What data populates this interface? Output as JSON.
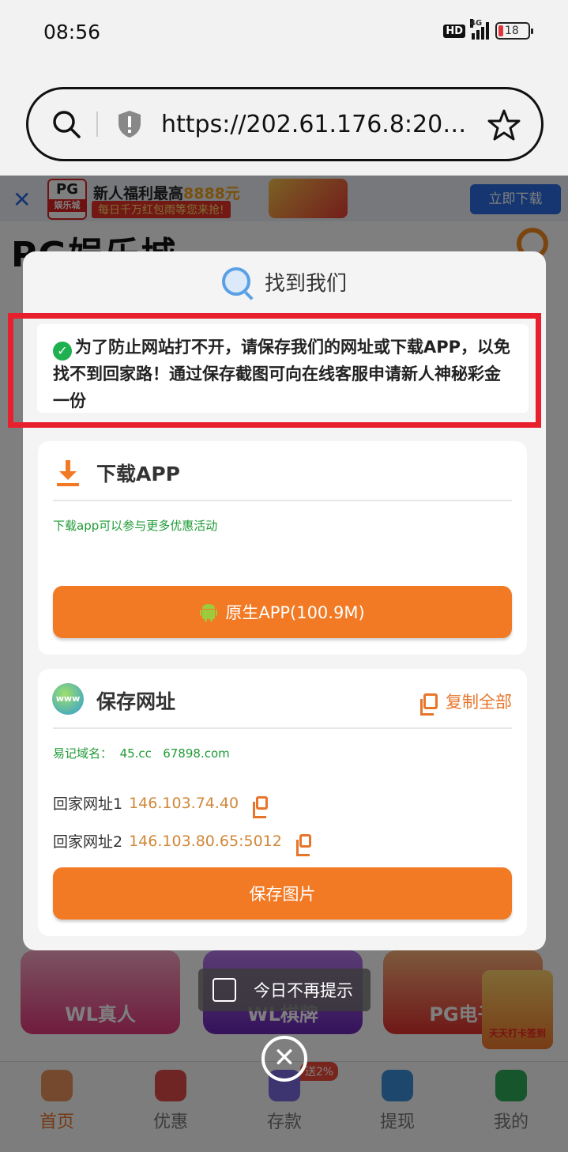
{
  "status_bar": {
    "time": "08:56",
    "hd": "HD",
    "network": "4G",
    "battery": "18"
  },
  "browser": {
    "url": "https://202.61.176.8:2000..."
  },
  "promo_banner": {
    "logo_top": "PG",
    "logo_bottom": "娱乐城",
    "title_prefix": "新人福利最高",
    "title_amount": "8888元",
    "subtitle": "每日千万红包雨等您来抢!",
    "download_button": "立即下载"
  },
  "site": {
    "logo": "PG娱乐城"
  },
  "tiles": [
    "WL真人",
    "WL棋牌",
    "PG电子"
  ],
  "float_badge": "天天打卡签到",
  "tabbar": {
    "items": [
      "首页",
      "优惠",
      "存款",
      "提现",
      "我的"
    ],
    "deposit_badge": "送2%"
  },
  "modal": {
    "title": "找到我们",
    "notice": "为了防止网站打不开，请保存我们的网址或下载APP，以免找不到回家路！通过保存截图可向在线客服申请新人神秘彩金一份",
    "download": {
      "title": "下载APP",
      "hint": "下载app可以参与更多优惠活动",
      "button": "原生APP(100.9M)"
    },
    "save": {
      "title": "保存网址",
      "copy_all": "复制全部",
      "easy_domain_label": "易记域名：",
      "easy_domains": "45.cc   67898.com",
      "addr1_label": "回家网址1",
      "addr1_value": "146.103.74.40",
      "addr2_label": "回家网址2",
      "addr2_value": "146.103.80.65:5012",
      "save_button": "保存图片"
    },
    "dont_show": "今日不再提示",
    "close": "✕"
  }
}
